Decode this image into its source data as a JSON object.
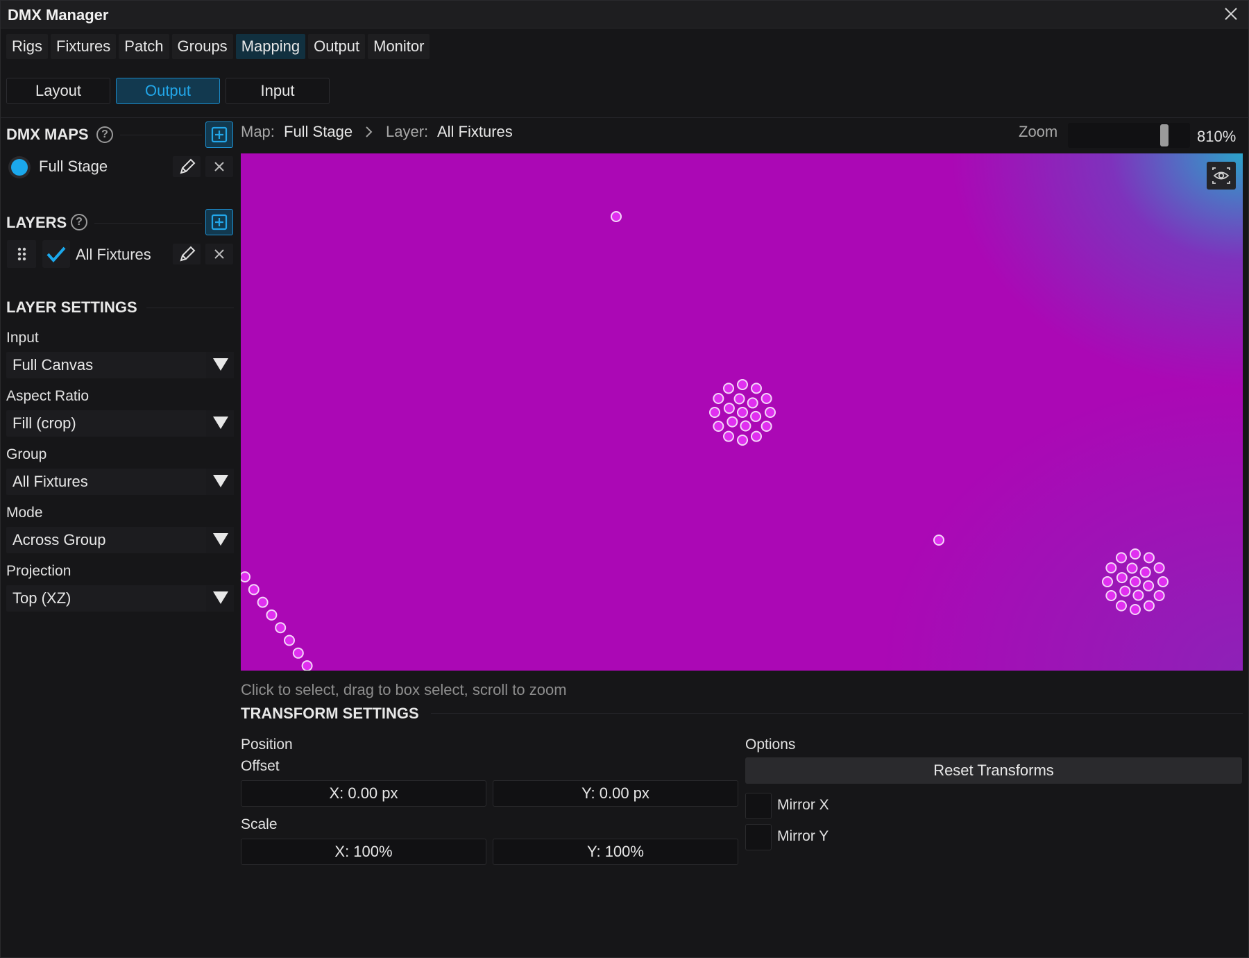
{
  "window": {
    "title": "DMX Manager"
  },
  "tabs": [
    "Rigs",
    "Fixtures",
    "Patch",
    "Groups",
    "Mapping",
    "Output",
    "Monitor"
  ],
  "active_tab": "Mapping",
  "modes": [
    "Layout",
    "Output",
    "Input"
  ],
  "active_mode": "Output",
  "dmx_maps": {
    "title": "DMX MAPS",
    "help": "?",
    "items": [
      {
        "name": "Full Stage",
        "color": "#1ba8ec"
      }
    ]
  },
  "layers": {
    "title": "LAYERS",
    "help": "?",
    "items": [
      {
        "name": "All Fixtures",
        "checked": true
      }
    ]
  },
  "layer_settings": {
    "title": "LAYER SETTINGS",
    "input_label": "Input",
    "input_value": "Full Canvas",
    "aspect_label": "Aspect Ratio",
    "aspect_value": "Fill (crop)",
    "group_label": "Group",
    "group_value": "All Fixtures",
    "mode_label": "Mode",
    "mode_value": "Across Group",
    "projection_label": "Projection",
    "projection_value": "Top (XZ)"
  },
  "breadcrumb": {
    "map_label": "Map:",
    "map_value": "Full Stage",
    "layer_label": "Layer:",
    "layer_value": "All Fixtures"
  },
  "zoom": {
    "label": "Zoom",
    "value": "810%",
    "level": 0.81
  },
  "hint": "Click to select, drag to box select, scroll to zoom",
  "transform": {
    "title": "TRANSFORM SETTINGS",
    "position_label": "Position",
    "offset_label": "Offset",
    "offset_x": "X: 0.00 px",
    "offset_y": "Y: 0.00 px",
    "scale_label": "Scale",
    "scale_x": "X: 100%",
    "scale_y": "Y: 100%",
    "options_label": "Options",
    "reset_label": "Reset Transforms",
    "mirror_x_label": "Mirror X",
    "mirror_y_label": "Mirror Y"
  },
  "colors": {
    "accent": "#1ba8ec",
    "canvas": "#ab08b5",
    "fixture": "#e02ff0"
  }
}
